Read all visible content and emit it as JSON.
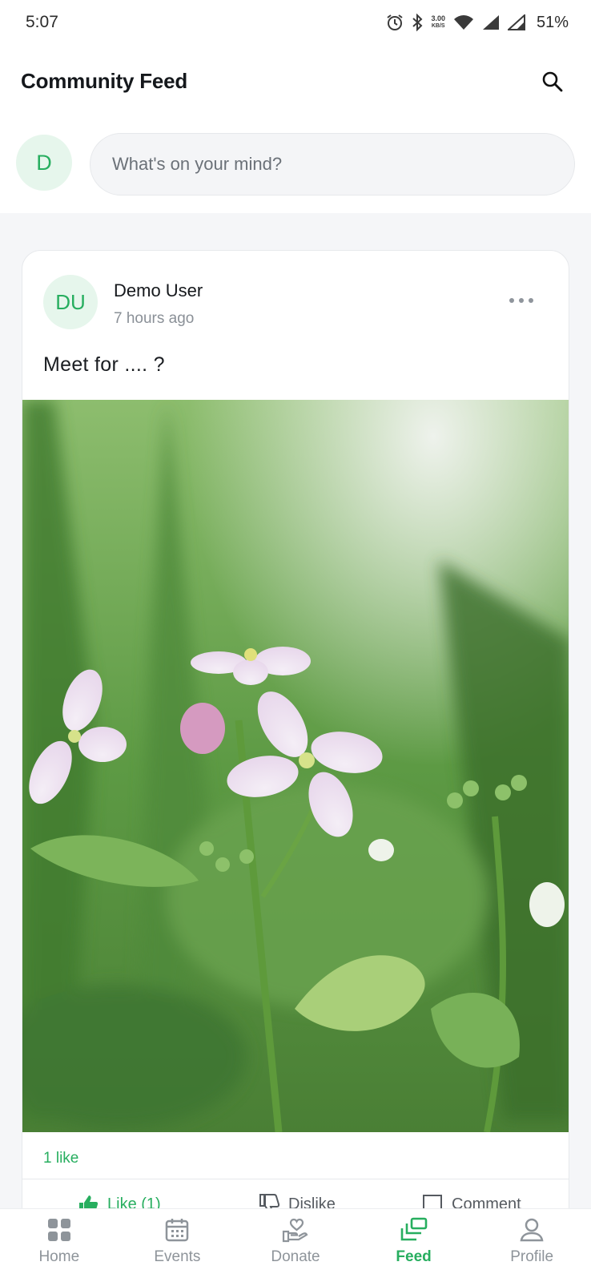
{
  "status_bar": {
    "time": "5:07",
    "net_speed_value": "3.00",
    "net_speed_unit": "KB/S",
    "battery": "51%",
    "icons": [
      "alarm-icon",
      "bluetooth-icon",
      "wifi-icon",
      "signal-icon",
      "signal-icon"
    ]
  },
  "header": {
    "title": "Community Feed",
    "search_icon": "search-icon"
  },
  "composer": {
    "avatar_initial": "D",
    "placeholder": "What's on your mind?"
  },
  "post": {
    "avatar_initials": "DU",
    "author": "Demo User",
    "time": "7 hours ago",
    "text": "Meet for .... ?",
    "likes_summary": "1 like",
    "actions": {
      "like": "Like (1)",
      "dislike": "Dislike",
      "comment": "Comment"
    }
  },
  "bottom_nav": {
    "items": [
      {
        "label": "Home",
        "icon": "grid-icon"
      },
      {
        "label": "Events",
        "icon": "calendar-icon"
      },
      {
        "label": "Donate",
        "icon": "donate-hand-heart-icon"
      },
      {
        "label": "Feed",
        "icon": "feed-cards-icon",
        "active": true
      },
      {
        "label": "Profile",
        "icon": "person-icon"
      }
    ]
  },
  "colors": {
    "accent": "#27ae5f",
    "avatar_bg": "#e6f6ec",
    "page_bg": "#f5f6f8",
    "muted_text": "#8e949a"
  }
}
